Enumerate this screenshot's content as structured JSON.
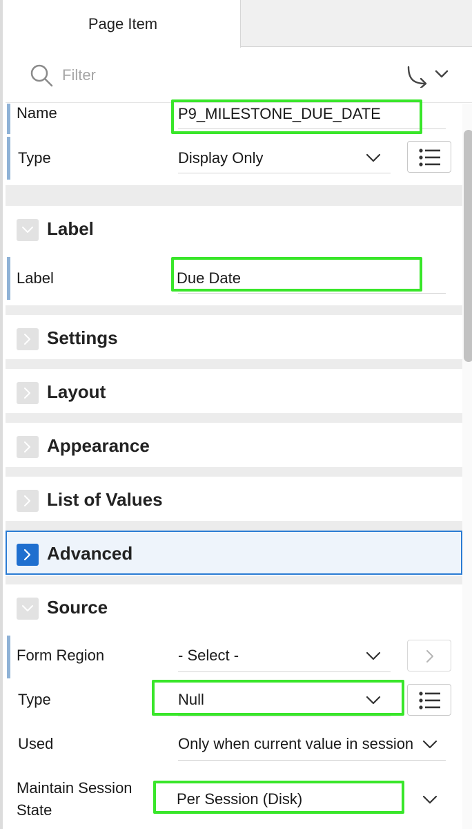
{
  "tabs": {
    "active": "Page Item"
  },
  "filter": {
    "placeholder": "Filter"
  },
  "identification": {
    "name_label": "Name",
    "name_value": "P9_MILESTONE_DUE_DATE",
    "type_label": "Type",
    "type_value": "Display Only"
  },
  "label_section": {
    "title": "Label",
    "label_label": "Label",
    "label_value": "Due Date"
  },
  "collapsed_sections": [
    "Settings",
    "Layout",
    "Appearance",
    "List of Values"
  ],
  "advanced": {
    "title": "Advanced"
  },
  "source": {
    "title": "Source",
    "form_region_label": "Form Region",
    "form_region_value": "- Select -",
    "type_label": "Type",
    "type_value": "Null",
    "used_label": "Used",
    "used_value": "Only when current value in session state is null",
    "maintain_label_1": "Maintain Session",
    "maintain_label_2": "State",
    "maintain_value": "Per Session (Disk)"
  },
  "colors": {
    "highlight": "#39e62a",
    "accent": "#1f6fcf",
    "field_bar": "#8fb2d6"
  },
  "icons": [
    "search-icon",
    "go-arrow-icon",
    "chevron-down-icon",
    "list-icon",
    "chevron-right-icon"
  ]
}
